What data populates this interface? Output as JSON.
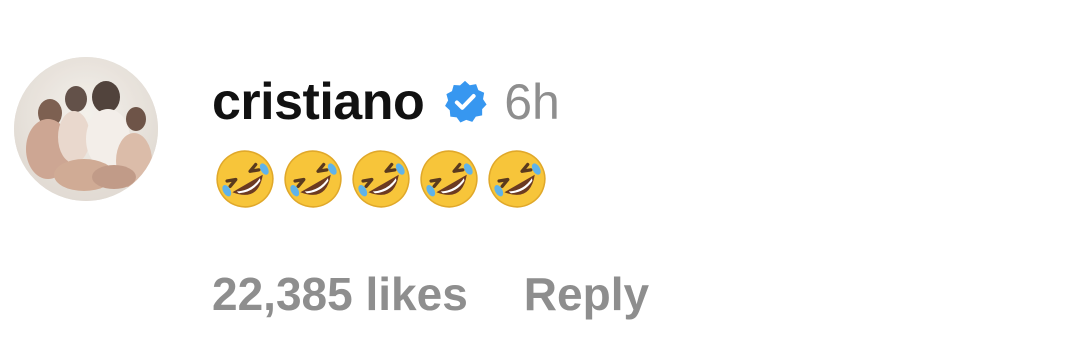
{
  "comment": {
    "avatar": {
      "icon": "profile-photo",
      "alt": ""
    },
    "username": "cristiano",
    "verified_icon": "verified-badge-icon",
    "verified_color": "#3797f0",
    "timestamp": "6h",
    "text_emojis": [
      "rolling-on-the-floor-laughing",
      "rolling-on-the-floor-laughing",
      "rolling-on-the-floor-laughing",
      "rolling-on-the-floor-laughing",
      "rolling-on-the-floor-laughing"
    ],
    "emoji_text": "🤣🤣🤣🤣🤣",
    "likes": "22,385 likes",
    "reply_label": "Reply"
  }
}
